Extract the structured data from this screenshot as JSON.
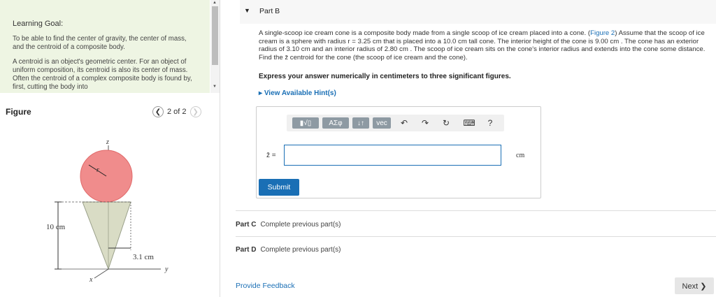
{
  "goal": {
    "title": "Learning Goal:",
    "para1": "To be able to find the center of gravity, the center of mass, and the centroid of a composite body.",
    "para2": "A centroid is an object's geometric center. For an object of uniform composition, its centroid is also its center of mass. Often the centroid of a complex composite body is found by, first, cutting the body into"
  },
  "figure": {
    "title": "Figure",
    "counter": "2 of 2",
    "labels": {
      "z": "z",
      "r": "r",
      "height": "10 cm",
      "radius": "3.1 cm",
      "x": "x",
      "y": "y"
    },
    "colors": {
      "scoop": "#f08c8c",
      "cone": "#d9dcc5"
    }
  },
  "partB": {
    "title": "Part B",
    "problem_a": "A single-scoop ice cream cone is a composite body made from a single scoop of ice cream placed into a cone. (",
    "figure_link": "Figure 2",
    "problem_b": ") Assume that the scoop of ice cream is a sphere with radius r = 3.25 cm that is placed into a 10.0 cm tall cone. The interior height of the cone is 9.00 cm . The cone has an exterior radius of 3.10 cm and an interior radius of 2.80 cm . The scoop of ice cream sits on the cone's interior radius and extends into the cone some distance. Find the z̄ centroid for the cone (the scoop of ice cream and the cone).",
    "instruction": "Express your answer numerically in centimeters to three significant figures.",
    "hints": "View Available Hint(s)",
    "toolbar": {
      "templates": "▮√▯",
      "greek": "ΑΣφ",
      "sort": "↓↑",
      "vec": "vec",
      "undo": "↶",
      "redo": "↷",
      "reset": "↻",
      "keyboard": "⌨",
      "help": "?"
    },
    "input_label": "z̄ =",
    "input_value": "",
    "unit": "cm",
    "submit": "Submit"
  },
  "partC": {
    "label": "Part C",
    "status": "Complete previous part(s)"
  },
  "partD": {
    "label": "Part D",
    "status": "Complete previous part(s)"
  },
  "footer": {
    "feedback": "Provide Feedback",
    "next": "Next ❯"
  }
}
